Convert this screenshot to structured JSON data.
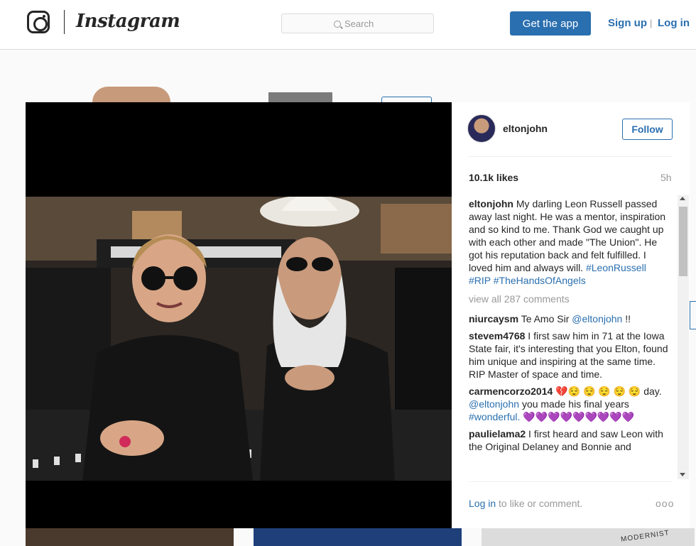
{
  "header": {
    "wordmark": "Instagram",
    "search_placeholder": "Search",
    "get_app_label": "Get the app",
    "signup_label": "Sign up",
    "separator": "|",
    "login_label": "Log in"
  },
  "colors": {
    "brand_blue": "#2a6faf",
    "muted_text": "#999999",
    "overlay_bg": "#000000"
  },
  "post": {
    "username": "eltonjohn",
    "follow_label": "Follow",
    "likes": "10.1k likes",
    "time_ago": "5h",
    "caption_user": "eltonjohn",
    "caption_text": "My darling Leon Russell passed away last night. He was a mentor, inspiration and so kind to me. Thank God we caught up with each other and made \"The Union\". He got his reputation back and felt fulfilled. I loved him and always will.",
    "caption_tags": [
      "#LeonRussell",
      "#RIP",
      "#TheHandsOfAngels"
    ],
    "view_all": "view all 287 comments",
    "comments": [
      {
        "user": "niurcaysm",
        "text_before": "Te Amo Sir",
        "mention": "@eltonjohn",
        "text_after": "!!"
      },
      {
        "user": "stevem4768",
        "text": "I first saw him in 71 at the Iowa State fair, it's interesting that you Elton, found him unique and inspiring at the same time. RIP Master of space and time."
      },
      {
        "user": "carmencorzo2014",
        "emoji_a": "💔😌 😌 😌 😌 😌",
        "text_a": "day.",
        "mention": "@eltonjohn",
        "text_b": "you made his final years",
        "tag": "#wonderful.",
        "emoji_b": "💜💜💜💜💜💜💜💜💜"
      },
      {
        "user": "paulielama2",
        "text": "I first heard and saw Leon with the Original Delaney and Bonnie and"
      }
    ],
    "login_link": "Log in",
    "login_suffix": "to like or comment.",
    "more_label": "ooo"
  },
  "background": {
    "thumb_text": "MODERNIST"
  }
}
